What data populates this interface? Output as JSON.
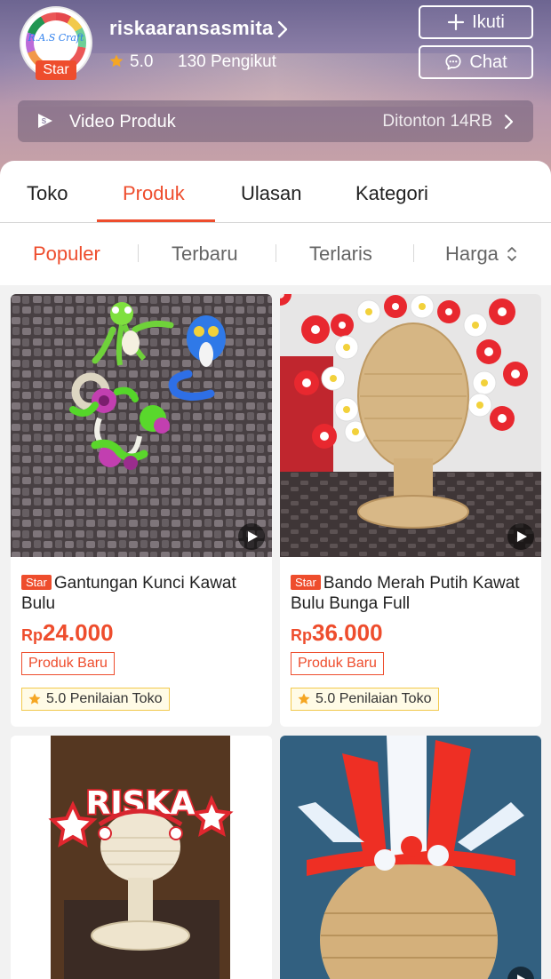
{
  "shop": {
    "name": "riskaaransasmita",
    "logo_text": "R.A.S Craft",
    "star_badge": "Star",
    "rating": "5.0",
    "followers": "130 Pengikut",
    "follow_label": "Ikuti",
    "chat_label": "Chat"
  },
  "video_bar": {
    "label": "Video Produk",
    "views": "Ditonton 14RB"
  },
  "main_tabs": [
    {
      "label": "Toko",
      "active": false
    },
    {
      "label": "Produk",
      "active": true
    },
    {
      "label": "Ulasan",
      "active": false
    },
    {
      "label": "Kategori",
      "active": false
    }
  ],
  "sort_tabs": [
    {
      "label": "Populer",
      "active": true
    },
    {
      "label": "Terbaru",
      "active": false
    },
    {
      "label": "Terlaris",
      "active": false
    },
    {
      "label": "Harga",
      "active": false
    }
  ],
  "products": [
    {
      "badge": "Star",
      "title": "Gantungan Kunci Kawat Bulu",
      "currency": "Rp",
      "price": "24.000",
      "tag": "Produk Baru",
      "shop_rating": "5.0 Penilaian Toko",
      "has_video": true
    },
    {
      "badge": "Star",
      "title": "Bando Merah Putih Kawat Bulu Bunga Full",
      "currency": "Rp",
      "price": "36.000",
      "tag": "Produk Baru",
      "shop_rating": "5.0 Penilaian Toko",
      "has_video": true
    },
    {
      "photo_text": "RISKA",
      "has_video": false
    },
    {
      "has_video": true
    }
  ],
  "colors": {
    "accent": "#ee4d2d",
    "rating_star": "#f5a623",
    "tag_border": "#f2c94c"
  },
  "icons": [
    "chevron-right-icon",
    "star-icon",
    "plus-icon",
    "chat-bubble-icon",
    "video-icon",
    "sort-icon",
    "play-icon"
  ]
}
